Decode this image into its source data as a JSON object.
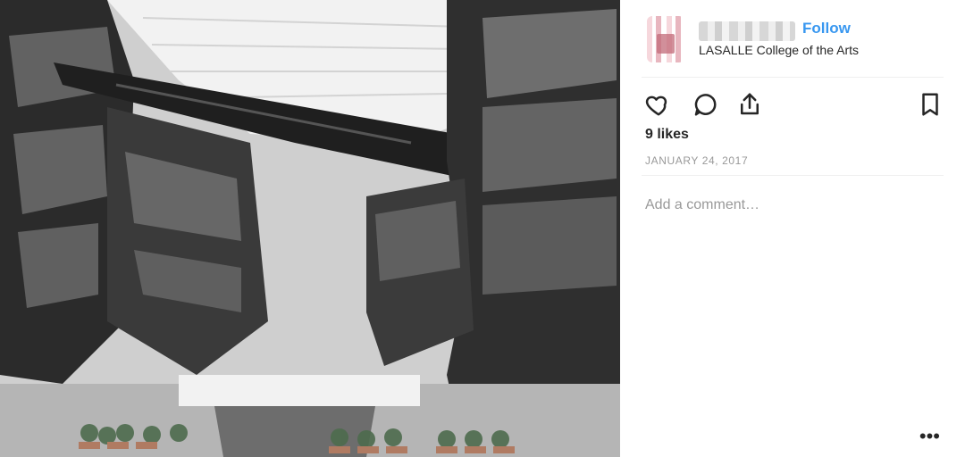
{
  "post": {
    "image": {
      "alt": ""
    },
    "header": {
      "follow_label": "Follow",
      "location": "LASALLE College of the Arts"
    },
    "actions": {
      "icons": [
        "heart-icon",
        "comment-icon",
        "share-icon",
        "bookmark-icon"
      ]
    },
    "likes": "9 likes",
    "date": "JANUARY 24, 2017",
    "comment": {
      "placeholder": "Add a comment…"
    },
    "more_label": "•••"
  },
  "colors": {
    "accent": "#3897f0",
    "text": "#262626",
    "muted": "#999999",
    "divider": "#efefef"
  }
}
